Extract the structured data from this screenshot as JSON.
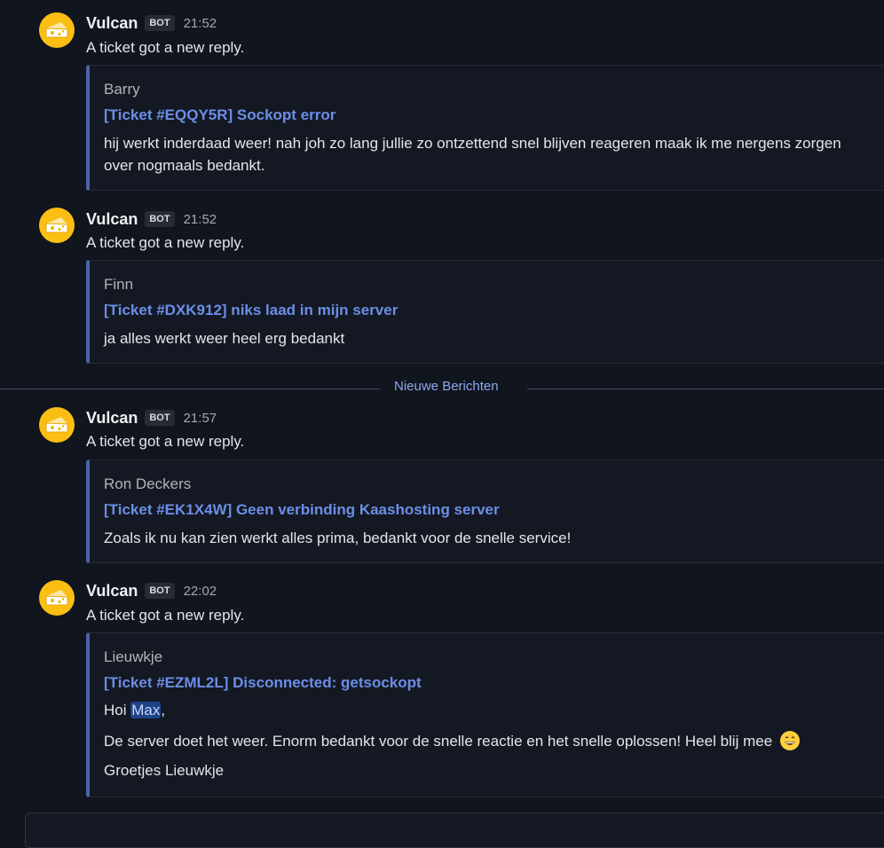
{
  "messages": [
    {
      "username": "Vulcan",
      "badge": "BOT",
      "time": "21:52",
      "content": "A ticket got a new reply.",
      "embed": {
        "author": "Barry",
        "title": "[Ticket #EQQY5R] Sockopt error",
        "description": "hij werkt inderdaad weer! nah joh zo lang jullie zo ontzettend snel blijven reageren maak ik me nergens zorgen over nogmaals bedankt."
      }
    },
    {
      "username": "Vulcan",
      "badge": "BOT",
      "time": "21:52",
      "content": "A ticket got a new reply.",
      "embed": {
        "author": "Finn",
        "title": "[Ticket #DXK912] niks laad in mijn server",
        "description": "ja alles werkt weer heel erg bedankt"
      }
    },
    {
      "username": "Vulcan",
      "badge": "BOT",
      "time": "21:57",
      "content": "A ticket got a new reply.",
      "embed": {
        "author": "Ron Deckers",
        "title": "[Ticket #EK1X4W] Geen verbinding Kaashosting server",
        "description": "Zoals ik nu kan zien werkt alles prima, bedankt voor de snelle service!"
      }
    },
    {
      "username": "Vulcan",
      "badge": "BOT",
      "time": "22:02",
      "content": "A ticket got a new reply.",
      "embed": {
        "author": "Lieuwkje",
        "title": "[Ticket #EZML2L] Disconnected: getsockopt",
        "greeting": "Hoi",
        "mention": "Max",
        "greeting_suffix": ",",
        "line2": "De server doet het weer. Enorm bedankt voor de snelle reactie en het snelle oplossen! Heel blij mee",
        "emoji": "grinning-face-emoji",
        "line3": "Groetjes Lieuwkje"
      }
    }
  ],
  "divider": {
    "label": "Nieuwe Berichten"
  },
  "colors": {
    "background": "#11151e",
    "embed_bar": "#4c63a7",
    "link": "#6b8ee6",
    "avatar": "#fbbf14",
    "new_messages": "#8ea8ee"
  }
}
